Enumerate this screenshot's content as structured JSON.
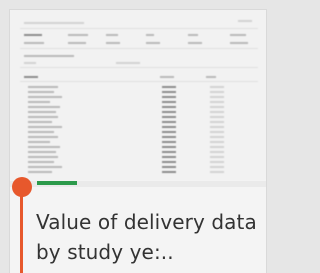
{
  "card": {
    "title": "Value of delivery data by study ye:..",
    "accent_color": "#e7582c",
    "progress_color": "#2c9a4b"
  }
}
